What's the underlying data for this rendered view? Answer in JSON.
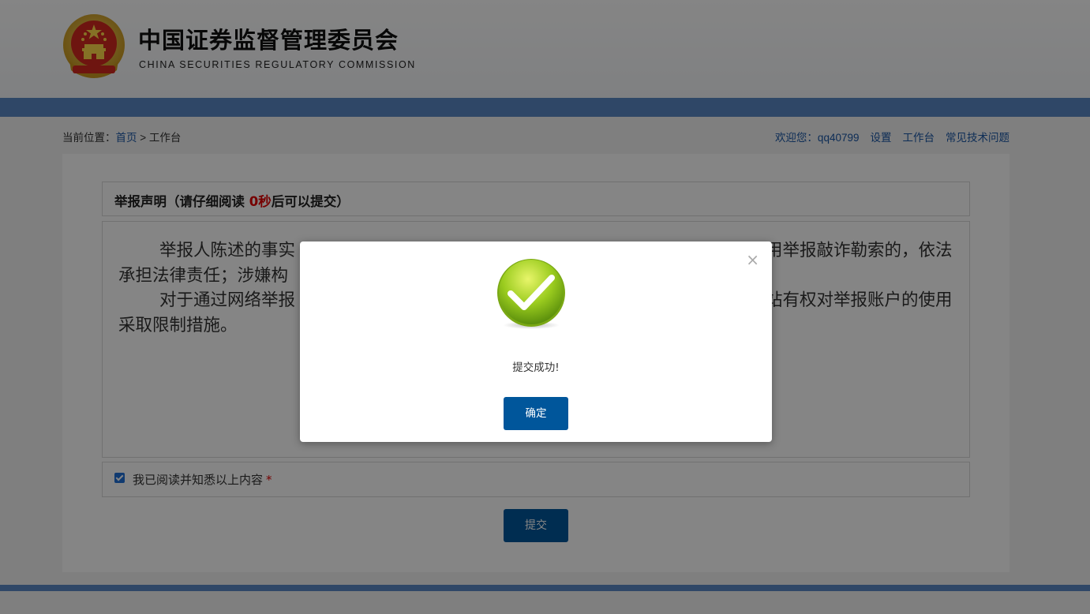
{
  "header": {
    "title_cn": "中国证券监督管理委员会",
    "title_en": "CHINA SECURITIES REGULATORY COMMISSION"
  },
  "breadcrumb": {
    "prefix": "当前位置：",
    "home": "首页",
    "separator": " > ",
    "current": "工作台"
  },
  "topnav": {
    "welcome": "欢迎您：qq40799",
    "settings": "设置",
    "workbench": "工作台",
    "faq": "常见技术问题"
  },
  "declaration": {
    "heading_before": "举报声明（请仔细阅读 ",
    "countdown": "0秒",
    "heading_after": "后可以提交）",
    "paragraph_1": "举报人陈述的事实",
    "paragraph_1_tail": "用举报敲诈勒索的，依法承担法律责任；涉嫌构",
    "paragraph_2": "对于通过网络举报",
    "paragraph_2_tail": "站有权对举报账户的使用采取限制措施。"
  },
  "agreement": {
    "label": "我已阅读并知悉以上内容",
    "required_mark": "*",
    "checked": true
  },
  "actions": {
    "submit_label": "提交"
  },
  "dialog": {
    "close_symbol": "×",
    "message": "提交成功!",
    "confirm_label": "确定",
    "icon": "success-check-icon"
  },
  "colors": {
    "brand_blue": "#5b89c5",
    "button_blue": "#00569b",
    "link_blue": "#1a56a6",
    "alert_red": "#e30000",
    "success_green": "#8cc21a"
  }
}
